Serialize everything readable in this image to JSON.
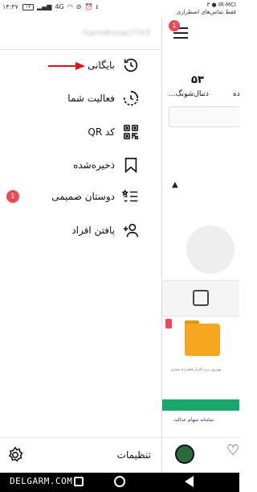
{
  "status_bar": {
    "time": "۱۴:۳۷",
    "carrier": "IR-MCI",
    "carrier_note": "فقط تماس‌های اضطراری",
    "battery": "۱۷",
    "notifications_count": "۳",
    "network": "4G"
  },
  "drawer": {
    "username": "hamidrezas7743",
    "menu": [
      {
        "label": "بایگانی",
        "icon": "archive-history-icon"
      },
      {
        "label": "فعالیت شما",
        "icon": "activity-icon"
      },
      {
        "label": "کد QR",
        "icon": "qr-code-icon"
      },
      {
        "label": "ذخیره‌شده",
        "icon": "bookmark-icon"
      },
      {
        "label": "دوستان صمیمی",
        "icon": "close-friends-list-icon",
        "badge": "1"
      },
      {
        "label": "یافتن افراد",
        "icon": "add-person-icon"
      }
    ],
    "settings_label": "تنظیمات"
  },
  "background": {
    "notification_badge": "1",
    "followers_count": "۵۳",
    "followers_label": "دنبال‌شونگ...",
    "following_label_partial": "ده",
    "thumb_caption": "بهترین نرم افزار فشرده سازی",
    "thumb2_caption": "سامانه سهام عدالت"
  },
  "watermark": "DELGARM.COM",
  "colors": {
    "accent_red": "#ed4956",
    "arrow_red": "#e0101a"
  }
}
